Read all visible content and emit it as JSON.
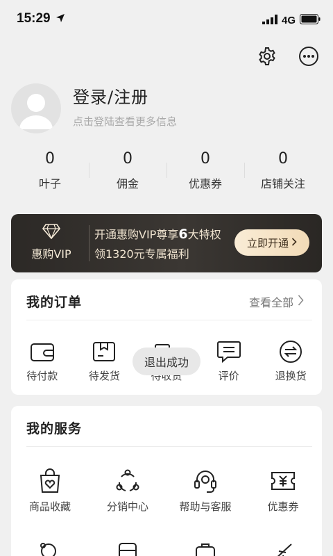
{
  "status_bar": {
    "time": "15:29",
    "network": "4G"
  },
  "profile": {
    "title": "登录/注册",
    "subtitle": "点击登陆查看更多信息"
  },
  "stats": [
    {
      "value": "0",
      "label": "叶子"
    },
    {
      "value": "0",
      "label": "佣金"
    },
    {
      "value": "0",
      "label": "优惠券"
    },
    {
      "value": "0",
      "label": "店铺关注"
    }
  ],
  "vip": {
    "logo_text": "惠购VIP",
    "line1_prefix": "开通惠购VIP尊享",
    "line1_number": "6",
    "line1_suffix": "大特权",
    "line2": "领1320元专属福利",
    "button": "立即开通"
  },
  "orders": {
    "title": "我的订单",
    "view_all": "查看全部",
    "items": [
      {
        "label": "待付款",
        "icon": "wallet-icon"
      },
      {
        "label": "待发货",
        "icon": "box-icon"
      },
      {
        "label": "待收货",
        "icon": "truck-icon"
      },
      {
        "label": "评价",
        "icon": "comment-icon"
      },
      {
        "label": "退换货",
        "icon": "return-icon"
      }
    ]
  },
  "services": {
    "title": "我的服务",
    "items": [
      {
        "label": "商品收藏",
        "icon": "heart-bag-icon"
      },
      {
        "label": "分销中心",
        "icon": "share-network-icon"
      },
      {
        "label": "帮助与客服",
        "icon": "headset-icon"
      },
      {
        "label": "优惠券",
        "icon": "coupon-icon"
      }
    ]
  },
  "toast": "退出成功",
  "colors": {
    "accent_gold": "#f2dbb7",
    "vip_dark": "#2c2926",
    "background": "#f0f0f0"
  }
}
